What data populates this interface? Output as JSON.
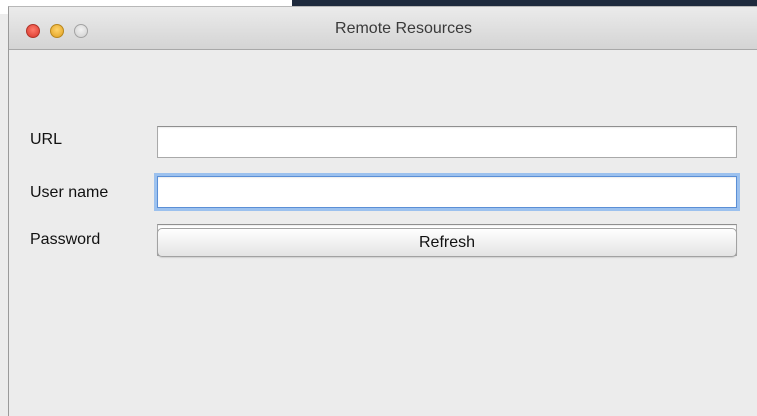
{
  "window": {
    "title": "Remote Resources"
  },
  "form": {
    "url": {
      "label": "URL",
      "value": "",
      "placeholder": ""
    },
    "username": {
      "label": "User name",
      "value": "",
      "placeholder": "",
      "focused": true
    },
    "password": {
      "label": "Password",
      "value": "",
      "placeholder": ""
    },
    "refresh_label": "Refresh"
  },
  "colors": {
    "focus_ring": "#9cc1ee",
    "close_button": "#d8362b",
    "minimize_button": "#e0a020",
    "zoom_button": "#cfcfcf",
    "window_background": "#ececec"
  }
}
